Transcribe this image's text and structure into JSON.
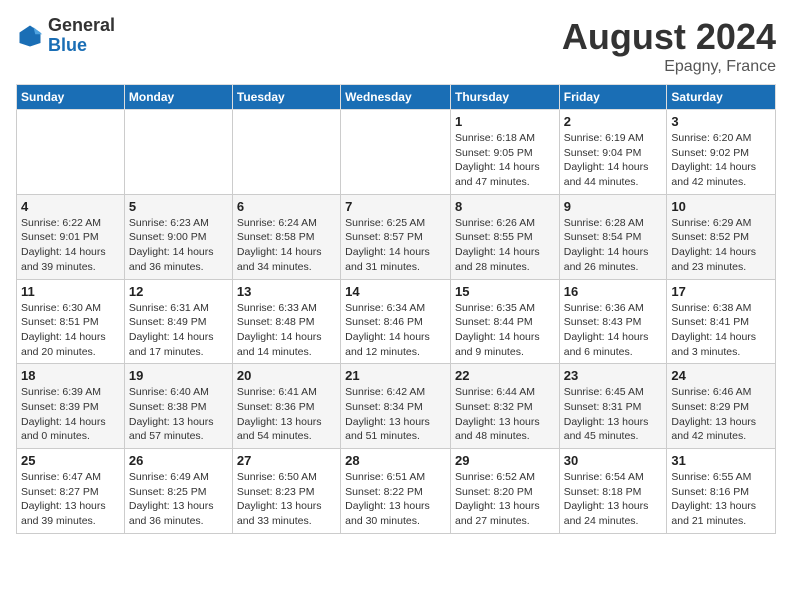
{
  "header": {
    "logo_general": "General",
    "logo_blue": "Blue",
    "month_year": "August 2024",
    "location": "Epagny, France"
  },
  "weekdays": [
    "Sunday",
    "Monday",
    "Tuesday",
    "Wednesday",
    "Thursday",
    "Friday",
    "Saturday"
  ],
  "weeks": [
    [
      {
        "day": "",
        "info": ""
      },
      {
        "day": "",
        "info": ""
      },
      {
        "day": "",
        "info": ""
      },
      {
        "day": "",
        "info": ""
      },
      {
        "day": "1",
        "info": "Sunrise: 6:18 AM\nSunset: 9:05 PM\nDaylight: 14 hours\nand 47 minutes."
      },
      {
        "day": "2",
        "info": "Sunrise: 6:19 AM\nSunset: 9:04 PM\nDaylight: 14 hours\nand 44 minutes."
      },
      {
        "day": "3",
        "info": "Sunrise: 6:20 AM\nSunset: 9:02 PM\nDaylight: 14 hours\nand 42 minutes."
      }
    ],
    [
      {
        "day": "4",
        "info": "Sunrise: 6:22 AM\nSunset: 9:01 PM\nDaylight: 14 hours\nand 39 minutes."
      },
      {
        "day": "5",
        "info": "Sunrise: 6:23 AM\nSunset: 9:00 PM\nDaylight: 14 hours\nand 36 minutes."
      },
      {
        "day": "6",
        "info": "Sunrise: 6:24 AM\nSunset: 8:58 PM\nDaylight: 14 hours\nand 34 minutes."
      },
      {
        "day": "7",
        "info": "Sunrise: 6:25 AM\nSunset: 8:57 PM\nDaylight: 14 hours\nand 31 minutes."
      },
      {
        "day": "8",
        "info": "Sunrise: 6:26 AM\nSunset: 8:55 PM\nDaylight: 14 hours\nand 28 minutes."
      },
      {
        "day": "9",
        "info": "Sunrise: 6:28 AM\nSunset: 8:54 PM\nDaylight: 14 hours\nand 26 minutes."
      },
      {
        "day": "10",
        "info": "Sunrise: 6:29 AM\nSunset: 8:52 PM\nDaylight: 14 hours\nand 23 minutes."
      }
    ],
    [
      {
        "day": "11",
        "info": "Sunrise: 6:30 AM\nSunset: 8:51 PM\nDaylight: 14 hours\nand 20 minutes."
      },
      {
        "day": "12",
        "info": "Sunrise: 6:31 AM\nSunset: 8:49 PM\nDaylight: 14 hours\nand 17 minutes."
      },
      {
        "day": "13",
        "info": "Sunrise: 6:33 AM\nSunset: 8:48 PM\nDaylight: 14 hours\nand 14 minutes."
      },
      {
        "day": "14",
        "info": "Sunrise: 6:34 AM\nSunset: 8:46 PM\nDaylight: 14 hours\nand 12 minutes."
      },
      {
        "day": "15",
        "info": "Sunrise: 6:35 AM\nSunset: 8:44 PM\nDaylight: 14 hours\nand 9 minutes."
      },
      {
        "day": "16",
        "info": "Sunrise: 6:36 AM\nSunset: 8:43 PM\nDaylight: 14 hours\nand 6 minutes."
      },
      {
        "day": "17",
        "info": "Sunrise: 6:38 AM\nSunset: 8:41 PM\nDaylight: 14 hours\nand 3 minutes."
      }
    ],
    [
      {
        "day": "18",
        "info": "Sunrise: 6:39 AM\nSunset: 8:39 PM\nDaylight: 14 hours\nand 0 minutes."
      },
      {
        "day": "19",
        "info": "Sunrise: 6:40 AM\nSunset: 8:38 PM\nDaylight: 13 hours\nand 57 minutes."
      },
      {
        "day": "20",
        "info": "Sunrise: 6:41 AM\nSunset: 8:36 PM\nDaylight: 13 hours\nand 54 minutes."
      },
      {
        "day": "21",
        "info": "Sunrise: 6:42 AM\nSunset: 8:34 PM\nDaylight: 13 hours\nand 51 minutes."
      },
      {
        "day": "22",
        "info": "Sunrise: 6:44 AM\nSunset: 8:32 PM\nDaylight: 13 hours\nand 48 minutes."
      },
      {
        "day": "23",
        "info": "Sunrise: 6:45 AM\nSunset: 8:31 PM\nDaylight: 13 hours\nand 45 minutes."
      },
      {
        "day": "24",
        "info": "Sunrise: 6:46 AM\nSunset: 8:29 PM\nDaylight: 13 hours\nand 42 minutes."
      }
    ],
    [
      {
        "day": "25",
        "info": "Sunrise: 6:47 AM\nSunset: 8:27 PM\nDaylight: 13 hours\nand 39 minutes."
      },
      {
        "day": "26",
        "info": "Sunrise: 6:49 AM\nSunset: 8:25 PM\nDaylight: 13 hours\nand 36 minutes."
      },
      {
        "day": "27",
        "info": "Sunrise: 6:50 AM\nSunset: 8:23 PM\nDaylight: 13 hours\nand 33 minutes."
      },
      {
        "day": "28",
        "info": "Sunrise: 6:51 AM\nSunset: 8:22 PM\nDaylight: 13 hours\nand 30 minutes."
      },
      {
        "day": "29",
        "info": "Sunrise: 6:52 AM\nSunset: 8:20 PM\nDaylight: 13 hours\nand 27 minutes."
      },
      {
        "day": "30",
        "info": "Sunrise: 6:54 AM\nSunset: 8:18 PM\nDaylight: 13 hours\nand 24 minutes."
      },
      {
        "day": "31",
        "info": "Sunrise: 6:55 AM\nSunset: 8:16 PM\nDaylight: 13 hours\nand 21 minutes."
      }
    ]
  ]
}
